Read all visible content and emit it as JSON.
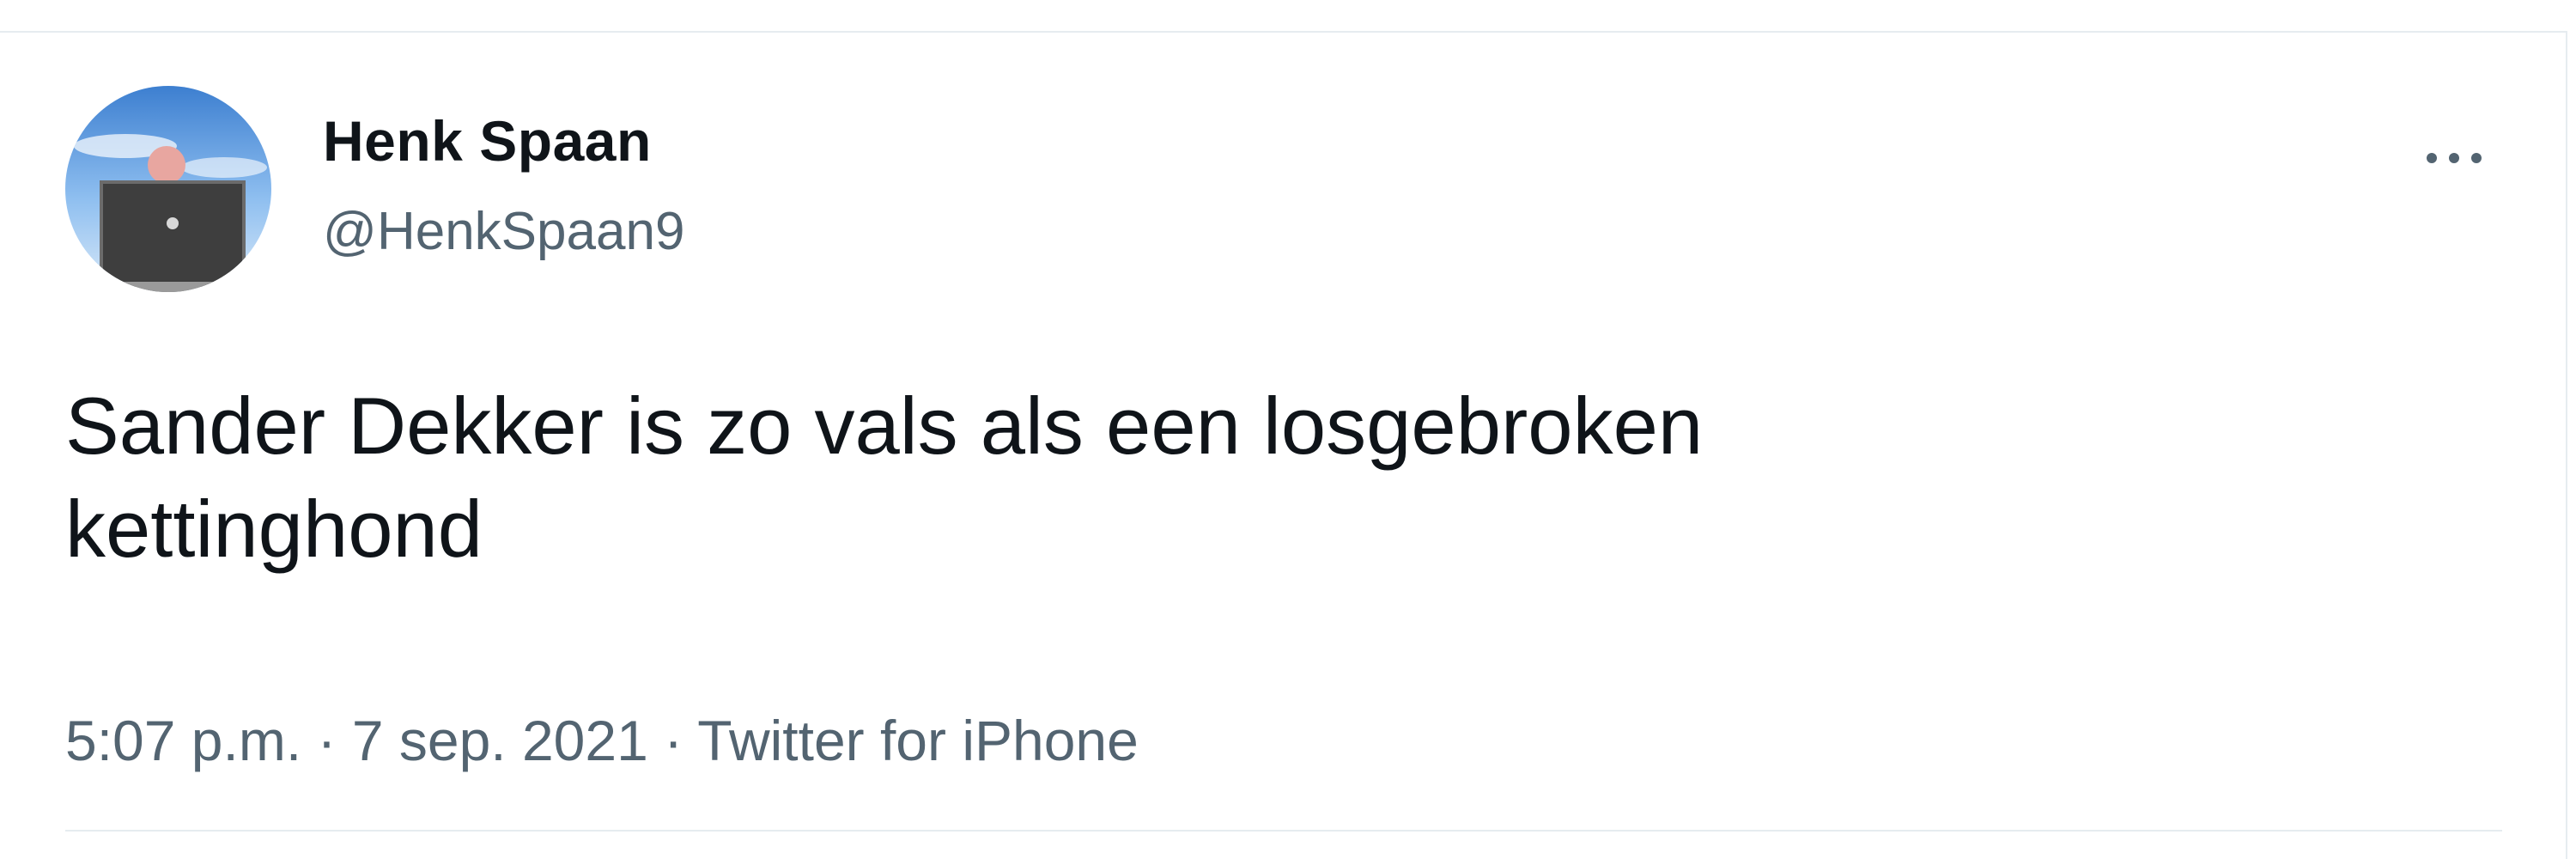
{
  "tweet": {
    "author": {
      "display_name": "Henk Spaan",
      "handle": "@HenkSpaan9",
      "avatar_icon": "avatar-laptop-sky"
    },
    "text": "Sander Dekker is zo vals als een losgebroken\nkettinghond",
    "time": "5:07 p.m.",
    "separator": "·",
    "date": "7 sep. 2021",
    "source": "Twitter for iPhone",
    "more_icon": "more-dots-icon"
  },
  "colors": {
    "text_primary": "#0f1419",
    "text_secondary": "#536471",
    "border": "#e6ecf0",
    "background": "#ffffff"
  }
}
